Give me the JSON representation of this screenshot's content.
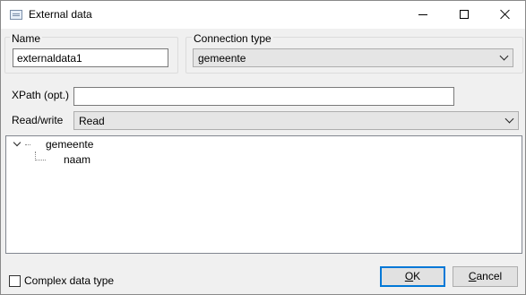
{
  "window": {
    "title": "External data",
    "icon": "window-app-icon"
  },
  "name_group": {
    "label": "Name",
    "value": "externaldata1"
  },
  "connection_group": {
    "label": "Connection type",
    "selected": "gemeente"
  },
  "xpath": {
    "label": "XPath (opt.)",
    "value": ""
  },
  "read_write": {
    "label": "Read/write",
    "selected": "Read"
  },
  "tree": {
    "root": {
      "label": "gemeente",
      "expanded": true,
      "children": [
        {
          "label": "naam"
        }
      ]
    }
  },
  "complex_type": {
    "label": "Complex data type",
    "checked": false
  },
  "buttons": {
    "ok_hotkey": "O",
    "ok_rest": "K",
    "cancel_hotkey": "C",
    "cancel_rest": "ancel"
  },
  "colors": {
    "focus_border": "#0078d7",
    "dialog_bg": "#f0f0f0"
  }
}
